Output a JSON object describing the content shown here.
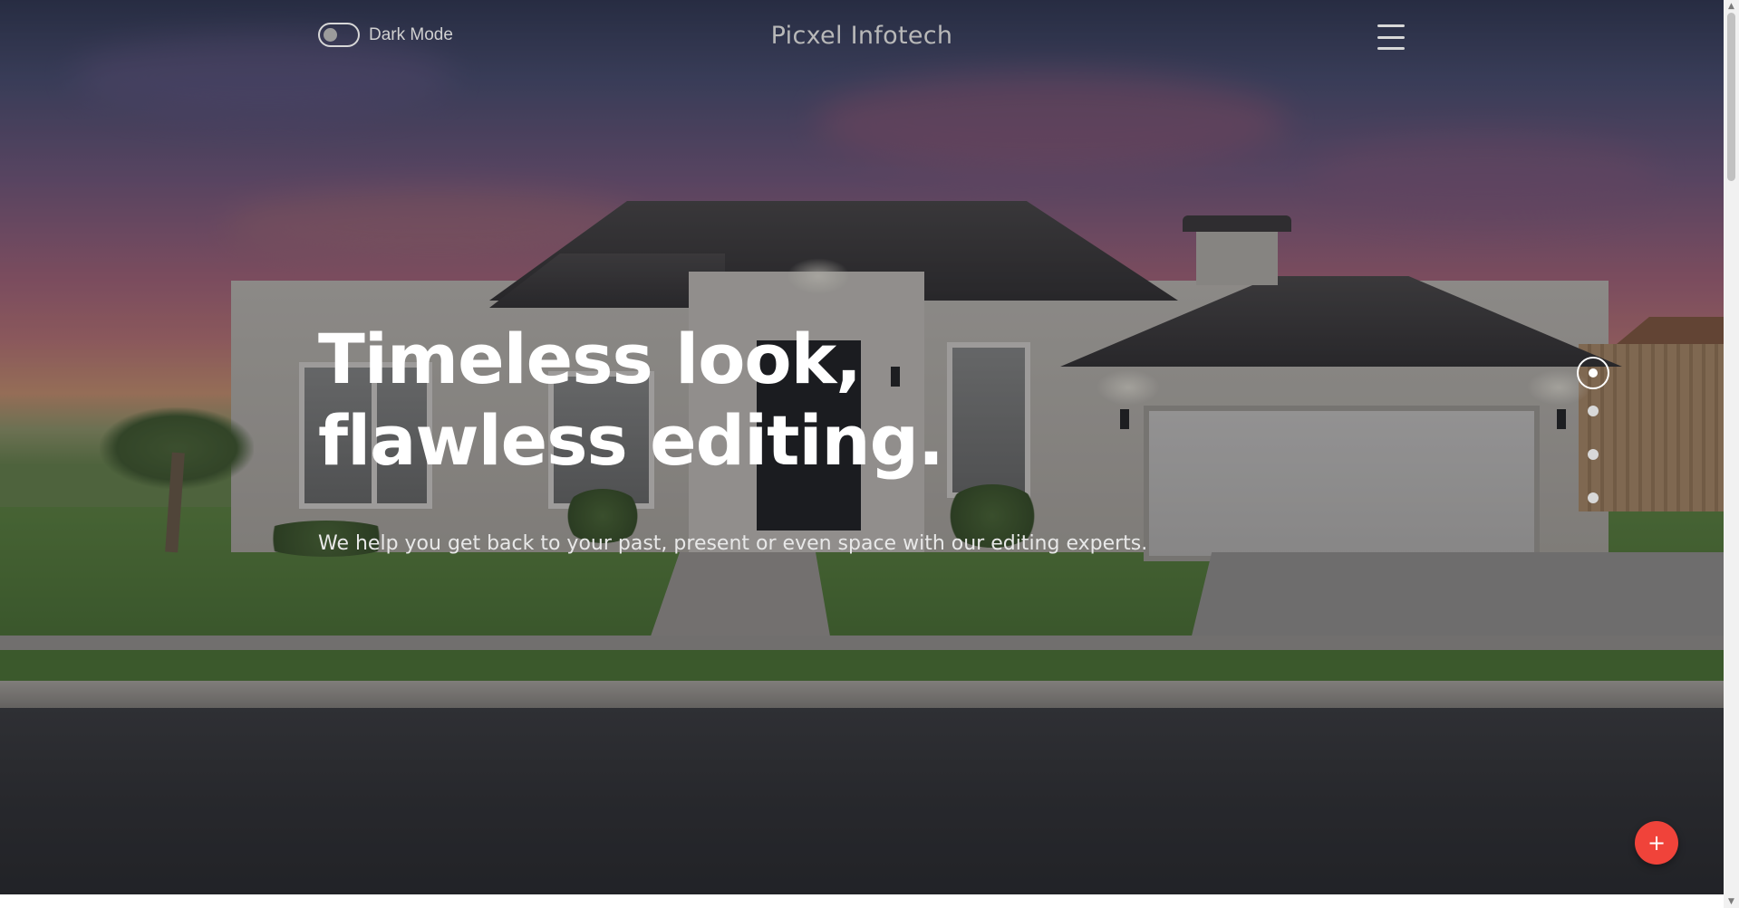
{
  "header": {
    "dark_mode_label": "Dark Mode",
    "dark_mode_on": false,
    "brand": "Picxel Infotech",
    "menu_icon": "hamburger-menu-icon"
  },
  "hero": {
    "title_line1": "Timeless look,",
    "title_line2": "flawless editing.",
    "subtitle": "We help you get back to your past, present or even space with our editing experts.",
    "background_image": "house-exterior-at-sunset"
  },
  "slider": {
    "slide_count": 4,
    "active_index": 0
  },
  "fab": {
    "label": "+",
    "icon": "plus-icon",
    "color": "#f0433a"
  },
  "colors": {
    "accent": "#f0433a",
    "title_text": "#ffffff",
    "brand_text": "#b8b8b8"
  }
}
